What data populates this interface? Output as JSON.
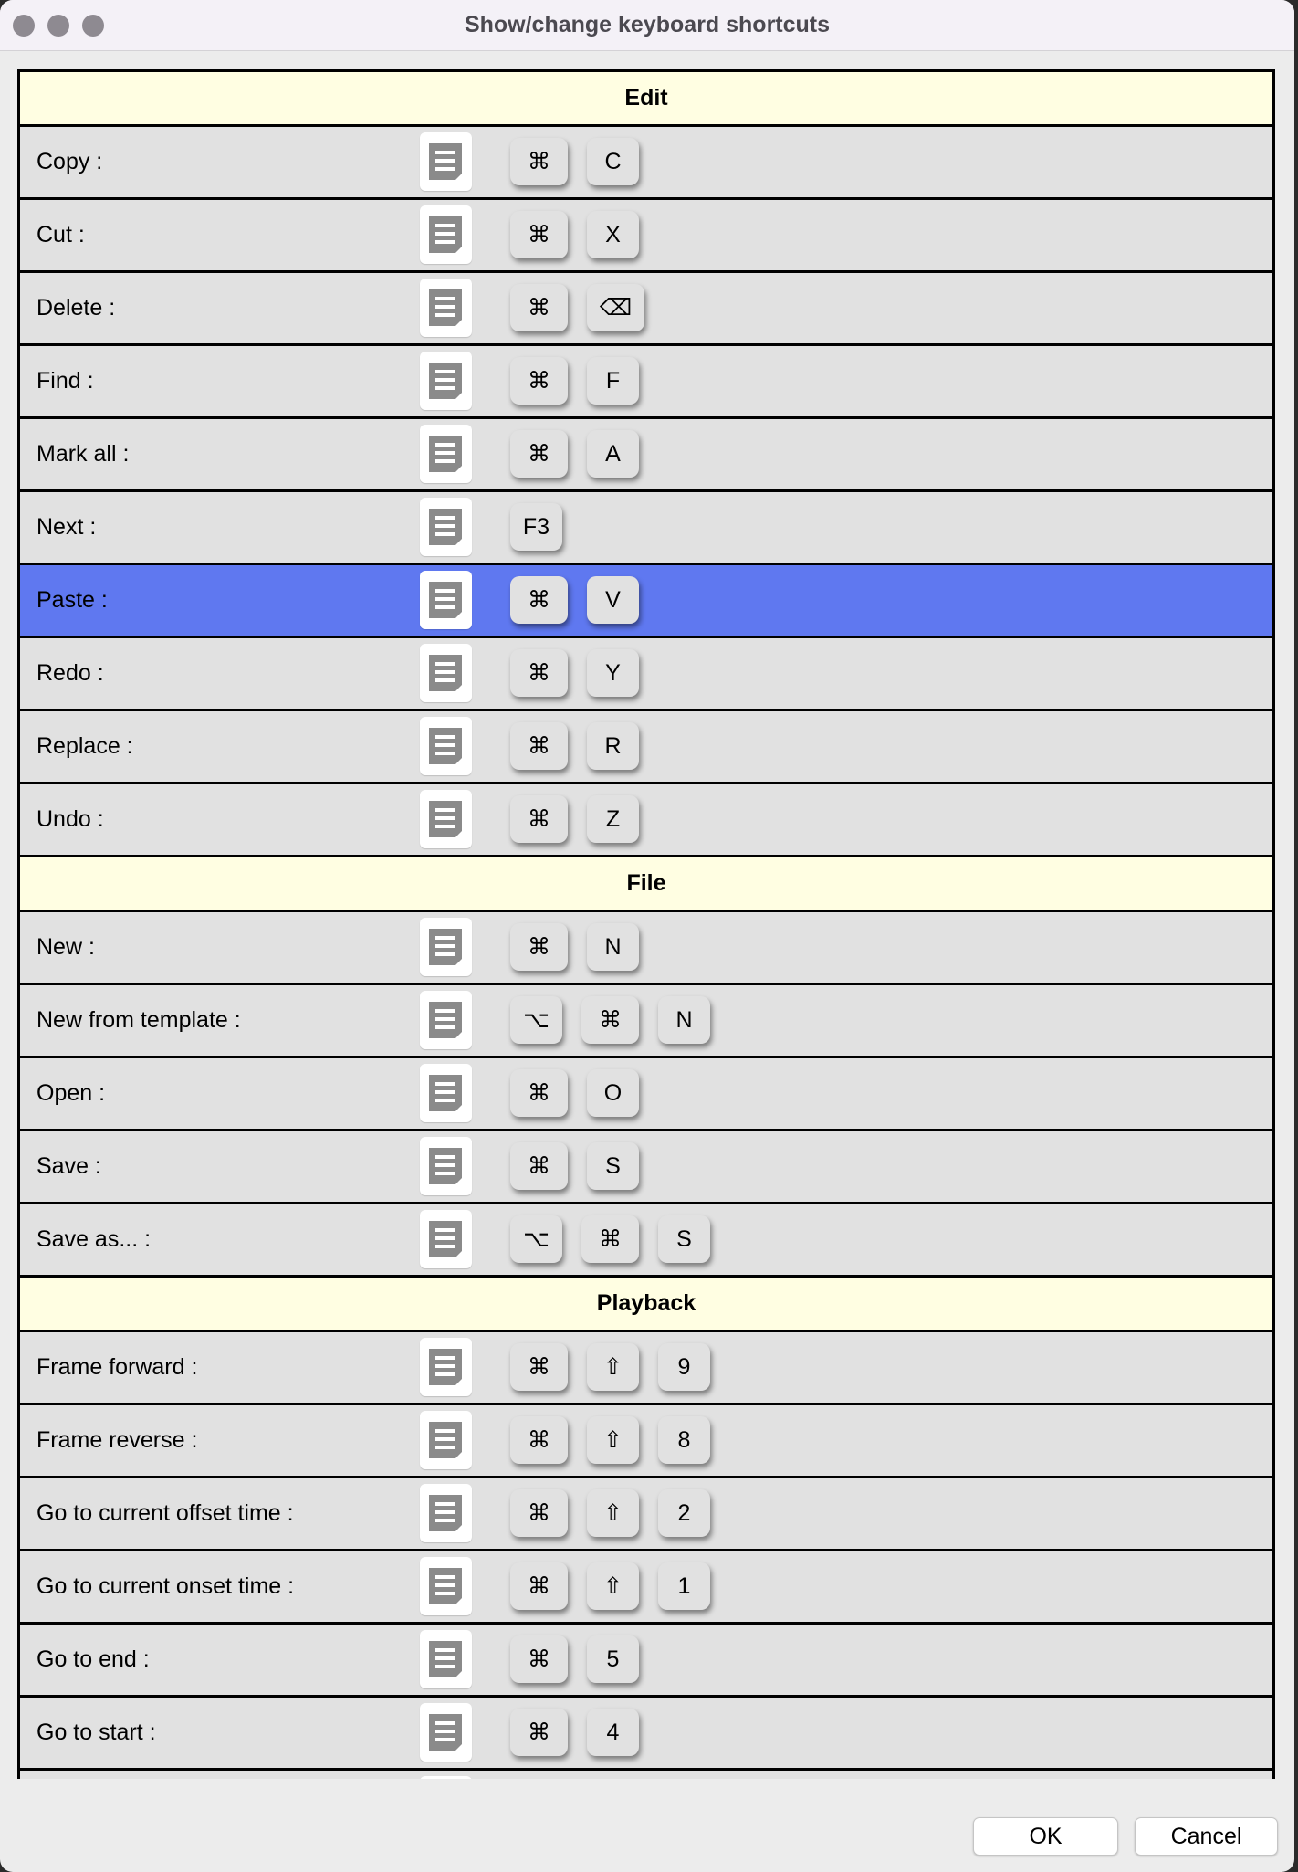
{
  "window": {
    "title": "Show/change keyboard shortcuts"
  },
  "sections": [
    {
      "title": "Edit",
      "items": [
        {
          "label": "Copy :",
          "keys": [
            "⌘",
            "C"
          ]
        },
        {
          "label": "Cut :",
          "keys": [
            "⌘",
            "X"
          ]
        },
        {
          "label": "Delete :",
          "keys": [
            "⌘",
            "⌫"
          ]
        },
        {
          "label": "Find :",
          "keys": [
            "⌘",
            "F"
          ]
        },
        {
          "label": "Mark all :",
          "keys": [
            "⌘",
            "A"
          ]
        },
        {
          "label": "Next :",
          "keys": [
            "F3"
          ]
        },
        {
          "label": "Paste :",
          "keys": [
            "⌘",
            "V"
          ],
          "selected": true
        },
        {
          "label": "Redo :",
          "keys": [
            "⌘",
            "Y"
          ]
        },
        {
          "label": "Replace :",
          "keys": [
            "⌘",
            "R"
          ]
        },
        {
          "label": "Undo :",
          "keys": [
            "⌘",
            "Z"
          ]
        }
      ]
    },
    {
      "title": "File",
      "items": [
        {
          "label": "New :",
          "keys": [
            "⌘",
            "N"
          ]
        },
        {
          "label": "New from template :",
          "keys": [
            "⌥",
            "⌘",
            "N"
          ]
        },
        {
          "label": "Open :",
          "keys": [
            "⌘",
            "O"
          ]
        },
        {
          "label": "Save :",
          "keys": [
            "⌘",
            "S"
          ]
        },
        {
          "label": "Save as... :",
          "keys": [
            "⌥",
            "⌘",
            "S"
          ]
        }
      ]
    },
    {
      "title": "Playback",
      "items": [
        {
          "label": "Frame forward :",
          "keys": [
            "⌘",
            "⇧",
            "9"
          ]
        },
        {
          "label": "Frame reverse :",
          "keys": [
            "⌘",
            "⇧",
            "8"
          ]
        },
        {
          "label": "Go to current offset time :",
          "keys": [
            "⌘",
            "⇧",
            "2"
          ]
        },
        {
          "label": "Go to current onset time :",
          "keys": [
            "⌘",
            "⇧",
            "1"
          ]
        },
        {
          "label": "Go to end :",
          "keys": [
            "⌘",
            "5"
          ]
        },
        {
          "label": "Go to start :",
          "keys": [
            "⌘",
            "4"
          ]
        },
        {
          "label": "",
          "keys": []
        }
      ]
    }
  ],
  "buttons": {
    "ok": "OK",
    "cancel": "Cancel"
  },
  "colors": {
    "section_header": "#fffee2",
    "row": "#e1e1e1",
    "selected_row": "#5f78f0"
  },
  "icons": {
    "shortcut_editor": "document-icon"
  }
}
